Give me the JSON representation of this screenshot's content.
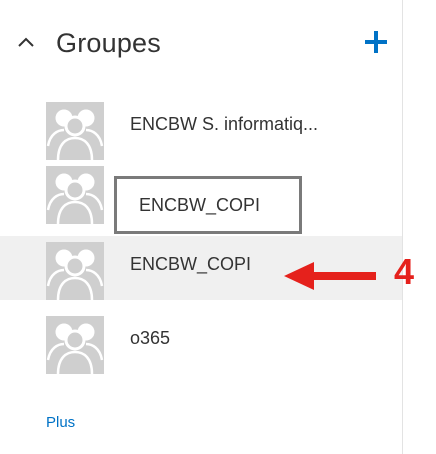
{
  "header": {
    "title": "Groupes",
    "collapse_icon": "chevron-up-icon",
    "add_icon": "plus-icon",
    "accent_color": "#0072c6"
  },
  "groups": [
    {
      "label": "ENCBW S. informatiq...",
      "icon": "group-people-icon"
    },
    {
      "label": "ENCBW_COPI",
      "icon": "group-people-icon",
      "editing": true
    },
    {
      "label": "ENCBW_COPI",
      "icon": "group-people-icon",
      "selected": true
    },
    {
      "label": "o365",
      "icon": "group-people-icon"
    }
  ],
  "more_link": "Plus",
  "annotation": {
    "step_number": "4",
    "color": "#e5211c"
  }
}
